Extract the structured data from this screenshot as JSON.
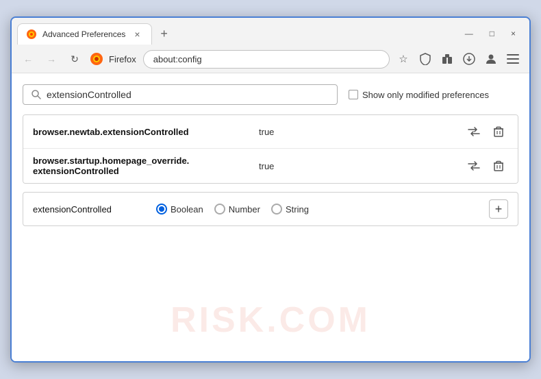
{
  "window": {
    "title": "Advanced Preferences",
    "tab_close": "×",
    "new_tab": "+",
    "win_minimize": "—",
    "win_restore": "□",
    "win_close": "×"
  },
  "navbar": {
    "back": "←",
    "forward": "→",
    "refresh": "↻",
    "firefox_label": "Firefox",
    "url": "about:config",
    "bookmark_icon": "☆",
    "shield_icon": "🛡",
    "extension_icon": "🧩",
    "download_icon": "📥",
    "profile_icon": "👤",
    "menu_icon": "≡"
  },
  "search": {
    "placeholder": "extensionControlled",
    "value": "extensionControlled",
    "show_modified_label": "Show only modified preferences"
  },
  "preferences": [
    {
      "name": "browser.newtab.extensionControlled",
      "value": "true"
    },
    {
      "name": "browser.startup.homepage_override.\nextensionControlled",
      "name_line1": "browser.startup.homepage_override.",
      "name_line2": "extensionControlled",
      "value": "true",
      "multiline": true
    }
  ],
  "new_pref": {
    "name": "extensionControlled",
    "types": [
      {
        "label": "Boolean",
        "selected": true
      },
      {
        "label": "Number",
        "selected": false
      },
      {
        "label": "String",
        "selected": false
      }
    ],
    "add_label": "+"
  },
  "watermark": "RISK.COM",
  "icons": {
    "search": "🔍",
    "swap": "⇌",
    "trash": "🗑"
  }
}
